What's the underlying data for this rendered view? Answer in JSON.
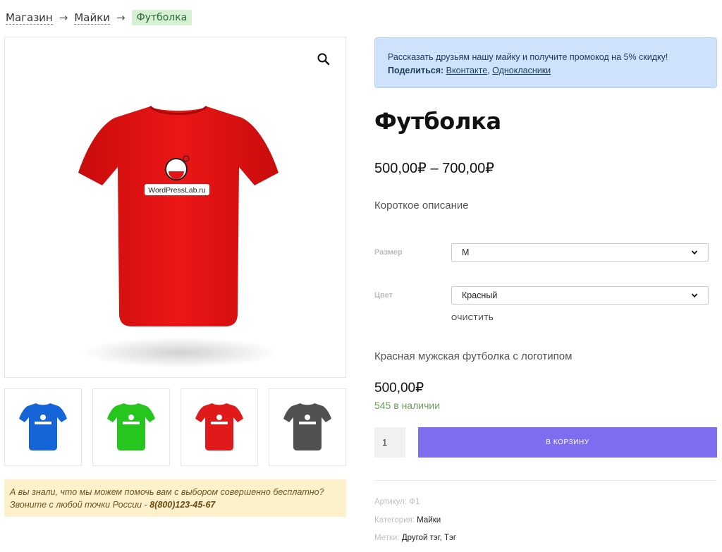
{
  "breadcrumb": {
    "items": [
      "Магазин",
      "Майки"
    ],
    "separator": "→",
    "current": "Футболка"
  },
  "gallery": {
    "main_logo_text": "WordPressLab.ru",
    "thumb_colors": [
      "#1565d8",
      "#27c61e",
      "#e01a1a",
      "#505050"
    ],
    "main_color": "#e31414"
  },
  "info_box": {
    "line1": "А вы знали, что мы можем помочь вам с выбором совершенно бесплатно?",
    "line2_prefix": "Звоните с любой точки России - ",
    "phone": "8(800)123-45-67"
  },
  "share": {
    "text": "Рассказать друзьям нашу майку и получите промокод на 5% скидку!",
    "label": "Поделиться:",
    "link1": "Вконтакте",
    "comma": ",",
    "link2": "Однокласники"
  },
  "product": {
    "title": "Футболка",
    "price_range": "500,00₽ – 700,00₽",
    "short_description": "Короткое описание"
  },
  "attributes": {
    "size_label": "Размер",
    "size_value": "M",
    "color_label": "Цвет",
    "color_value": "Красный",
    "clear_label": "ОЧИСТИТЬ"
  },
  "variation": {
    "description": "Красная мужская футболка с логотипом",
    "price": "500,00₽",
    "stock": "545 в наличии"
  },
  "cart": {
    "quantity": "1",
    "add_label": "В КОРЗИНУ"
  },
  "meta": {
    "sku_label": "Артикул:",
    "sku_value": "Ф1",
    "category_label": "Категория:",
    "category_value": "Майки",
    "tags_label": "Метки:",
    "tag1": "Другой тэг",
    "tag_sep": ",",
    "tag2": "Тэг"
  },
  "colors": {
    "accent": "#7f6df0",
    "share_bg": "#cfe2fb",
    "info_bg": "#fdf1cc",
    "stock_green": "#6a9d5a"
  }
}
